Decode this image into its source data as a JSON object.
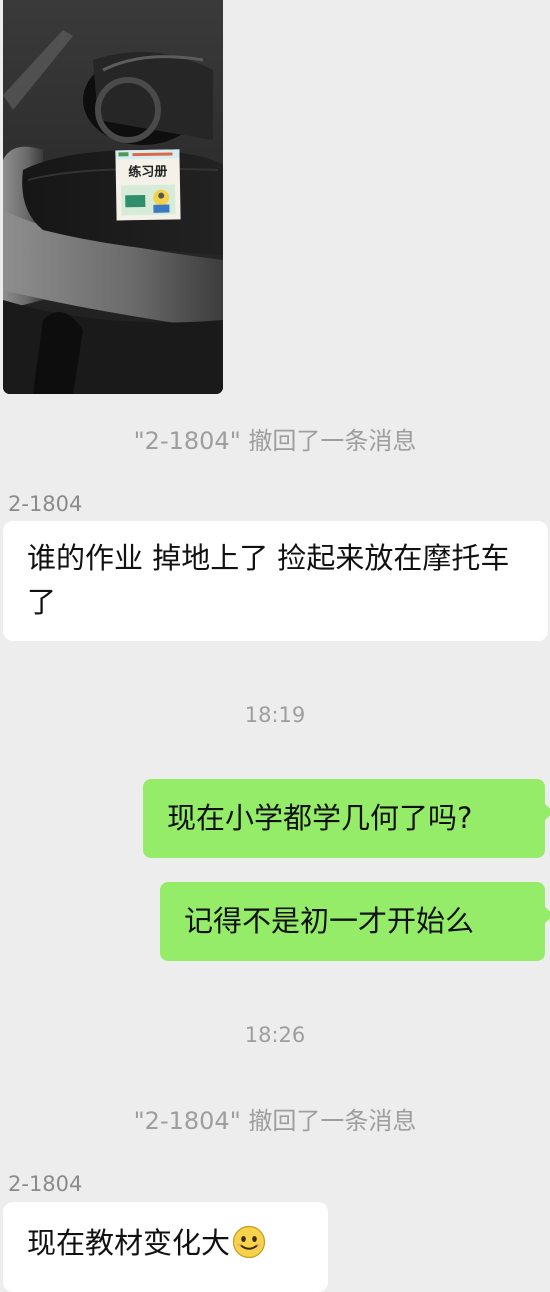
{
  "messages": {
    "recall_notice_1": "\"2-1804\" 撤回了一条消息",
    "sender_1": "2-1804",
    "incoming_1": "谁的作业 掉地上了 捡起来放在摩托车了",
    "time_1": "18:19",
    "outgoing_1": "现在小学都学几何了吗?",
    "outgoing_2": "记得不是初一才开始么",
    "time_2": "18:26",
    "recall_notice_2": "\"2-1804\" 撤回了一条消息",
    "sender_2": "2-1804",
    "incoming_2": "现在教材变化大"
  },
  "photo": {
    "book_title": "练习册"
  },
  "icons": {
    "emoji": "smiling-face-emoji-icon"
  },
  "colors": {
    "background": "#ededed",
    "incoming_bubble": "#ffffff",
    "outgoing_bubble": "#95ec69",
    "meta_text": "#9e9e9e"
  }
}
